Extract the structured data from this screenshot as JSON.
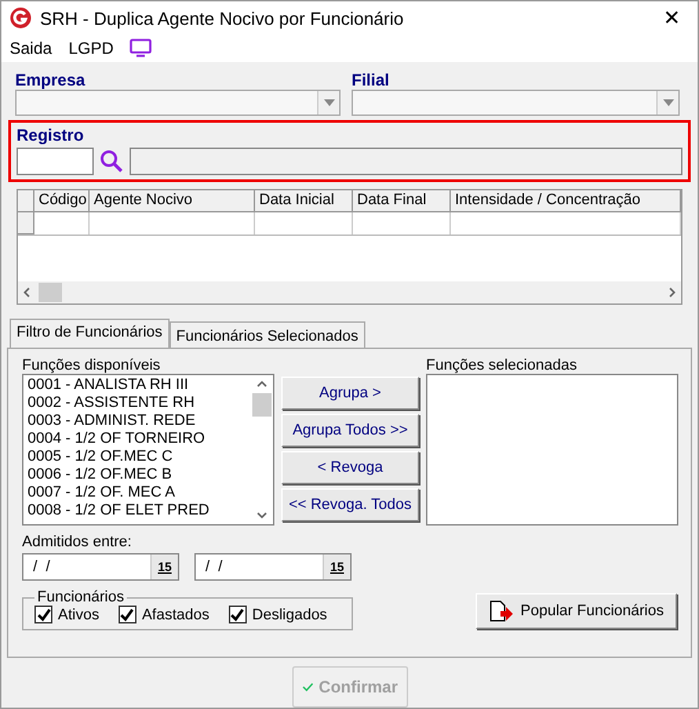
{
  "window": {
    "title": "SRH - Duplica Agente Nocivo por Funcionário",
    "close": "✕"
  },
  "menu": [
    "Saida",
    "LGPD"
  ],
  "empresa": {
    "label": "Empresa"
  },
  "filial": {
    "label": "Filial"
  },
  "registro": {
    "label": "Registro"
  },
  "grid": {
    "columns": [
      "Código",
      "Agente Nocivo",
      "Data Inicial",
      "Data Final",
      "Intensidade /  Concentração"
    ]
  },
  "tabs": [
    {
      "label": "Filtro de Funcionários",
      "selected": true
    },
    {
      "label": "Funcionários Selecionados",
      "selected": false
    }
  ],
  "available": {
    "label": "Funções disponíveis",
    "items": [
      "0001 - ANALISTA RH III",
      "0002 - ASSISTENTE RH",
      "0003 - ADMINIST. REDE",
      "0004 - 1/2 OF TORNEIRO",
      "0005 - 1/2 OF.MEC C",
      "0006 - 1/2 OF.MEC B",
      "0007 - 1/2 OF. MEC A",
      "0008 - 1/2 OF ELET PRED"
    ]
  },
  "move_buttons": [
    "Agrupa >",
    "Agrupa Todos >>",
    "< Revoga",
    "<< Revoga. Todos"
  ],
  "selected_list": {
    "label": "Funções selecionadas"
  },
  "admitted": {
    "label": "Admitidos entre:",
    "dates": [
      {
        "value": " /  /",
        "calendar": "15"
      },
      {
        "value": " /  /",
        "calendar": "15"
      }
    ]
  },
  "status_group": {
    "label": "Funcionários",
    "options": [
      {
        "label": "Ativos",
        "checked": true
      },
      {
        "label": "Afastados",
        "checked": true
      },
      {
        "label": "Desligados",
        "checked": true
      }
    ]
  },
  "populate_button": "Popular Funcionários",
  "confirm": {
    "label": "Confirmar",
    "disabled": true
  }
}
